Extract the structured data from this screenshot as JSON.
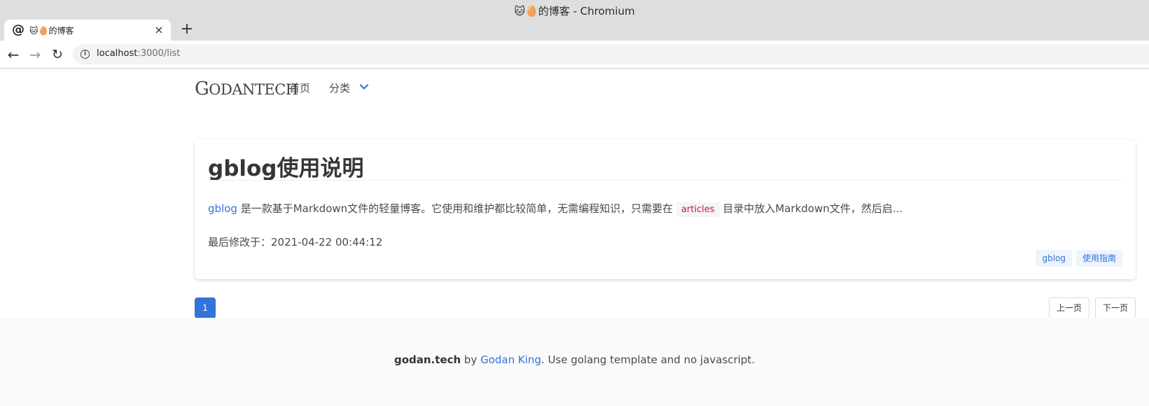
{
  "window": {
    "title": "🐱🥚的博客 - Chromium"
  },
  "tab": {
    "label": "🐱🥚的博客",
    "icon": "at-sign-icon",
    "close": "×",
    "new_tab": "+"
  },
  "toolbar": {
    "back": "←",
    "forward": "→",
    "reload": "↻",
    "url_host": "localhost",
    "url_path": ":3000/list"
  },
  "site": {
    "logo_first": "G",
    "logo_rest": "ODANTECH",
    "nav_home": "首页",
    "nav_category": "分类"
  },
  "post": {
    "title": "gblog使用说明",
    "excerpt_link": "gblog",
    "excerpt_part1": " 是一款基于Markdown文件的轻量博客。它使用和维护都比较简单，无需编程知识，只需要在 ",
    "excerpt_code": "articles",
    "excerpt_part2": " 目录中放入Markdown文件，然后启...",
    "modified_label": "最后修改于：",
    "modified_value": "2021-04-22 00:44:12",
    "tags": [
      "gblog",
      "使用指南"
    ]
  },
  "pagination": {
    "current": "1",
    "prev": "上一页",
    "next": "下一页"
  },
  "footer": {
    "brand": "godan.tech",
    "by": " by ",
    "author": "Godan King",
    "rest": ". Use golang template and no javascript."
  },
  "colors": {
    "accent": "#3273dc",
    "code": "#da1039",
    "footer_bg": "#fafafa"
  }
}
